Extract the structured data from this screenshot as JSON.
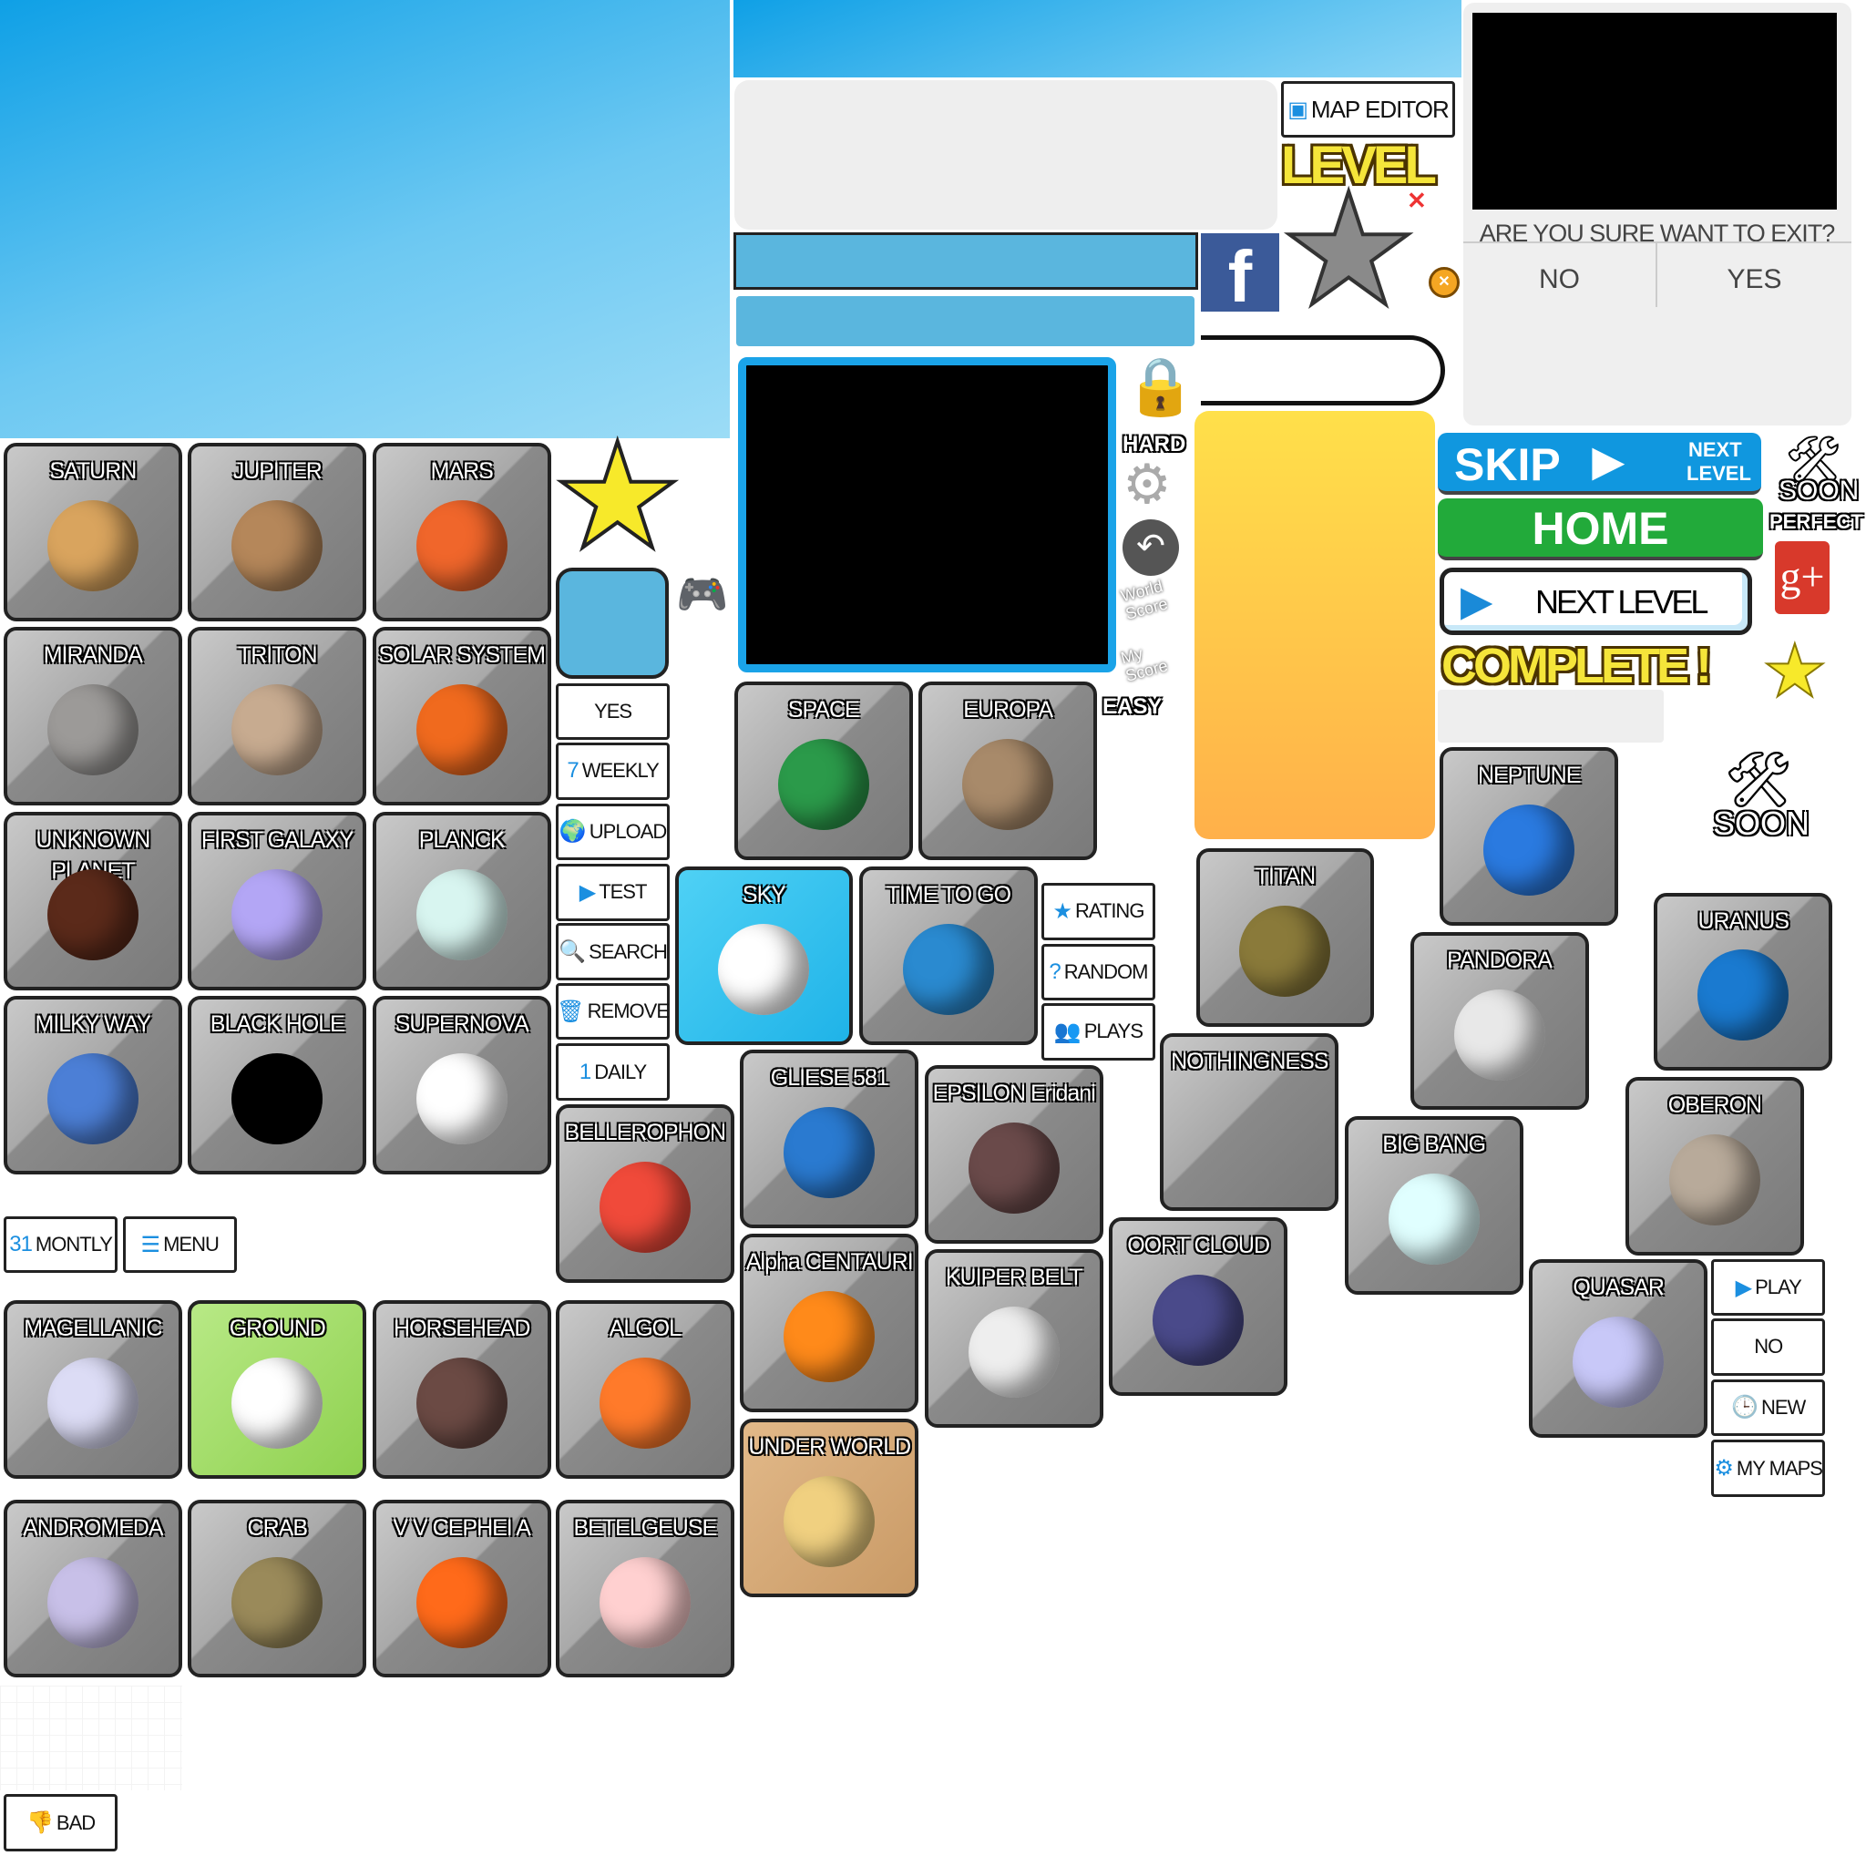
{
  "colors": {
    "sky": "#1aa3e8",
    "home": "#22aa3a",
    "skip": "#1097df",
    "orange_panel_top": "#ffe04a",
    "orange_panel_bottom": "#ffb04a"
  },
  "tiles": [
    {
      "label": "SATURN",
      "color": "#d9a45e"
    },
    {
      "label": "JUPITER",
      "color": "#b5875a"
    },
    {
      "label": "MARS",
      "color": "#f0662b"
    },
    {
      "label": "MIRANDA",
      "color": "#9c9a98"
    },
    {
      "label": "TRITON",
      "color": "#c7ab90"
    },
    {
      "label": "SOLAR SYSTEM",
      "color": "#f06a1e"
    },
    {
      "label": "UNKNOWN PLANET",
      "color": "#5b2a1a"
    },
    {
      "label": "FIRST GALAXY",
      "color": "#b3a6f5"
    },
    {
      "label": "PLANCK",
      "color": "#d8f5f0"
    },
    {
      "label": "MILKY WAY",
      "color": "#4c7fd6"
    },
    {
      "label": "BLACK HOLE",
      "color": "#000000"
    },
    {
      "label": "SUPERNOVA",
      "color": "#ffffff"
    },
    {
      "label": "BELLEROPHON",
      "color": "#f04a3a"
    },
    {
      "label": "MAGELLANIC",
      "color": "#dcdcf5"
    },
    {
      "label": "GROUND",
      "color": "#ffffff"
    },
    {
      "label": "HORSEHEAD",
      "color": "#6b4a44"
    },
    {
      "label": "ALGOL",
      "color": "#ff7a2a"
    },
    {
      "label": "ANDROMEDA",
      "color": "#c8c0e8"
    },
    {
      "label": "CRAB",
      "color": "#9a8a5a"
    },
    {
      "label": "V V CEPHEI A",
      "color": "#ff6a1a"
    },
    {
      "label": "BETELGEUSE",
      "color": "#ffd0d0"
    },
    {
      "label": "SPACE",
      "color": "#2b9a4a"
    },
    {
      "label": "EUROPA",
      "color": "#a88a6a"
    },
    {
      "label": "SKY",
      "color": "#ffffff"
    },
    {
      "label": "TIME TO GO",
      "color": "#2a8ad0"
    },
    {
      "label": "GLIESE 581",
      "color": "#2a7ad0"
    },
    {
      "label": "EPSILON Eridani",
      "color": "#6a4a4a"
    },
    {
      "label": "Alpha CENTAURI",
      "color": "#ff8a1a"
    },
    {
      "label": "KUIPER BELT",
      "color": "#eeeeee"
    },
    {
      "label": "UNDER WORLD",
      "color": "#f0d080"
    },
    {
      "label": "OORT CLOUD",
      "color": "#4a4a8a"
    },
    {
      "label": "TITAN",
      "color": "#8a7a3a"
    },
    {
      "label": "NOTHINGNESS",
      "color": ""
    },
    {
      "label": "BIG BANG",
      "color": "#e0ffff"
    },
    {
      "label": "NEPTUNE",
      "color": "#2a7ae0"
    },
    {
      "label": "PANDORA",
      "color": "#e8e8e8"
    },
    {
      "label": "URANUS",
      "color": "#1a7ad0"
    },
    {
      "label": "OBERON",
      "color": "#b8aa9a"
    },
    {
      "label": "QUASAR",
      "color": "#c8c8f8"
    }
  ],
  "buttons": [
    {
      "label": "YES",
      "icon": ""
    },
    {
      "label": "WEEKLY",
      "icon": "7"
    },
    {
      "label": "UPLOAD",
      "icon": "🌍"
    },
    {
      "label": "TEST",
      "icon": "▶"
    },
    {
      "label": "SEARCH",
      "icon": "🔍"
    },
    {
      "label": "REMOVE",
      "icon": "🗑"
    },
    {
      "label": "DAILY",
      "icon": "1"
    },
    {
      "label": "MONTLY",
      "icon": "31"
    },
    {
      "label": "MENU",
      "icon": "☰"
    },
    {
      "label": "RATING",
      "icon": "★"
    },
    {
      "label": "RANDOM",
      "icon": "?"
    },
    {
      "label": "PLAYS",
      "icon": "👥"
    },
    {
      "label": "PLAY",
      "icon": "▶"
    },
    {
      "label": "NO",
      "icon": ""
    },
    {
      "label": "NEW",
      "icon": "🕒"
    },
    {
      "label": "MY MAPS",
      "icon": "⚙"
    },
    {
      "label": "BAD",
      "icon": "👎"
    }
  ],
  "map_editor": "MAP EDITOR",
  "level_title": "LEVEL",
  "exit_dialog": {
    "question": "ARE YOU SURE WANT TO EXIT?",
    "no": "NO",
    "yes": "YES"
  },
  "skip": {
    "label": "SKIP",
    "next": "NEXT",
    "level": "LEVEL"
  },
  "home": "HOME",
  "next_level": "NEXT LEVEL",
  "complete": "COMPLETE !",
  "soon": "SOON",
  "perfect": "PERFECT",
  "hard": "HARD",
  "easy": "EASY",
  "world_score": "World Score",
  "my_score": "My Score",
  "facebook": "f",
  "gplus": "g+"
}
